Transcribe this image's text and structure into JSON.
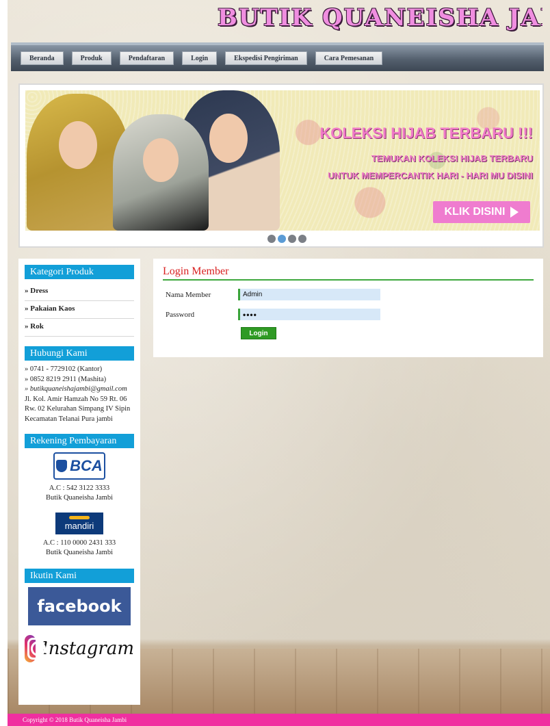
{
  "header": {
    "site_title": "BUTIK QUANEISHA JAMBI"
  },
  "nav": {
    "items": [
      "Beranda",
      "Produk",
      "Pendaftaran",
      "Login",
      "Ekspedisi Pengiriman",
      "Cara Pemesanan"
    ]
  },
  "banner": {
    "title": "KOLEKSI HIJAB TERBARU !!!",
    "subtitle_1": "TEMUKAN KOLEKSI HIJAB TERBARU",
    "subtitle_2": "UNTUK MEMPERCANTIK HARI - HARI MU DISINI",
    "cta_label": "KLIK DISINI",
    "active_slide": 2,
    "slide_count": 4
  },
  "sidebar": {
    "kategori_title": "Kategori Produk",
    "kategori_items": [
      "» Dress",
      "» Pakaian Kaos",
      "» Rok"
    ],
    "hubungi_title": "Hubungi Kami",
    "contact_lines": [
      "» 0741 - 7729102 (Kantor)",
      "» 0852 8219 2911 (Mashita)",
      "» butikquaneishajambi@gmail.com",
      "Jl. Kol. Amir Hamzah No 59 Rt. 06 Rw. 02 Kelurahan Simpang IV Sipin Kecamatan Telanai Pura jambi"
    ],
    "rekening_title": "Rekening Pembayaran",
    "banks": [
      {
        "logo": "BCA",
        "account": "A.C : 542 3122 3333",
        "holder": "Butik Quaneisha Jambi"
      },
      {
        "logo": "mandiri",
        "account": "A.C : 110 0000 2431 333",
        "holder": "Butik Quaneisha Jambi"
      }
    ],
    "ikutin_title": "Ikutin Kami",
    "facebook_label": "facebook",
    "instagram_label": "Instagram"
  },
  "login": {
    "title": "Login Member",
    "username_label": "Nama Member",
    "username_value": "Admin",
    "password_label": "Password",
    "password_value": "••••",
    "submit_label": "Login"
  },
  "footer": {
    "copyright": "Copyright © 2018 Butik Quaneisha Jambi"
  },
  "colors": {
    "accent_pink": "#f02fa0",
    "sidebar_head": "#129fd8",
    "login_green": "#2f9a24",
    "title_red": "#d92020"
  }
}
